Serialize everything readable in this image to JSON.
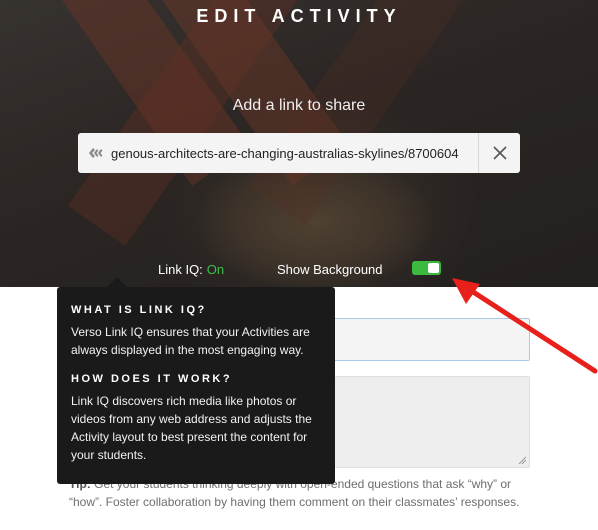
{
  "page": {
    "title": "EDIT ACTIVITY",
    "add_link_label": "Add a link to share"
  },
  "link_input": {
    "value": "genous-architects-are-changing-australias-skylines/8700604",
    "icon": "link-icon",
    "clear_icon": "close-icon"
  },
  "link_iq": {
    "label": "Link IQ:",
    "status": "On",
    "status_color": "#3cc04a"
  },
  "show_background": {
    "label": "Show Background",
    "enabled": true,
    "toggle_color": "#3cba3f"
  },
  "tooltip": {
    "heading1": "WHAT IS LINK IQ?",
    "body1": "Verso Link IQ ensures that your Activities are always displayed in the most engaging way.",
    "heading2": "HOW DOES IT WORK?",
    "body2": "Link IQ discovers rich media like photos or videos from any web address and adjusts the Activity layout to best present the content for your students."
  },
  "tip": {
    "label": "Tip:",
    "text": "Get your students thinking deeply with open-ended questions that ask “why” or “how”. Foster collaboration by having them comment on their classmates’ responses."
  },
  "annotation": {
    "arrow_color": "#e8201c"
  }
}
